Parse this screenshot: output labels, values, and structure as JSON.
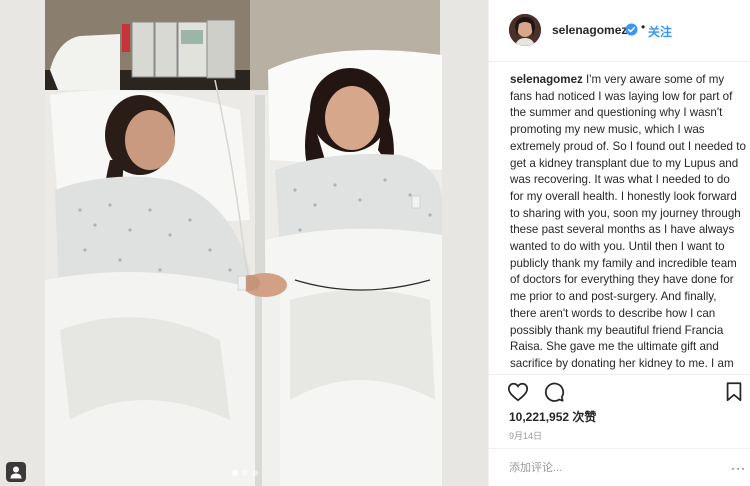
{
  "post": {
    "username": "selenagomez",
    "follow_label": "关注",
    "separator": "•",
    "caption_user": "selenagomez",
    "caption_text": "I'm very aware some of my fans had noticed I was laying low for part of the summer and questioning why I wasn't promoting my new music, which I was extremely proud of. So I found out I needed to get a kidney transplant due to my Lupus and was recovering. It was what I needed to do for my overall health. I honestly look forward to sharing with you, soon my journey through these past several months as I have always wanted to do with you. Until then I want to publicly thank my family and incredible team of doctors for everything they have done for me prior to and post-surgery. And finally, there aren't words to describe how I can possibly thank my beautiful friend Francia Raisa. She gave me the ultimate gift and sacrifice by donating her kidney to me. I am incredibly blessed. I love you so much sis.",
    "likes": "10,221,952 次赞",
    "date": "9月14日",
    "comment_placeholder": "添加评论...",
    "more_label": "···"
  },
  "icons": {
    "verified": "verified-badge-icon",
    "like": "heart-icon",
    "comment": "comment-icon",
    "save": "bookmark-icon",
    "tag": "user-tag-icon"
  },
  "carousel": {
    "count": 3,
    "active": 1
  },
  "colors": {
    "accent": "#3897f0",
    "text": "#262626",
    "muted": "#999999",
    "border": "#efefef"
  }
}
